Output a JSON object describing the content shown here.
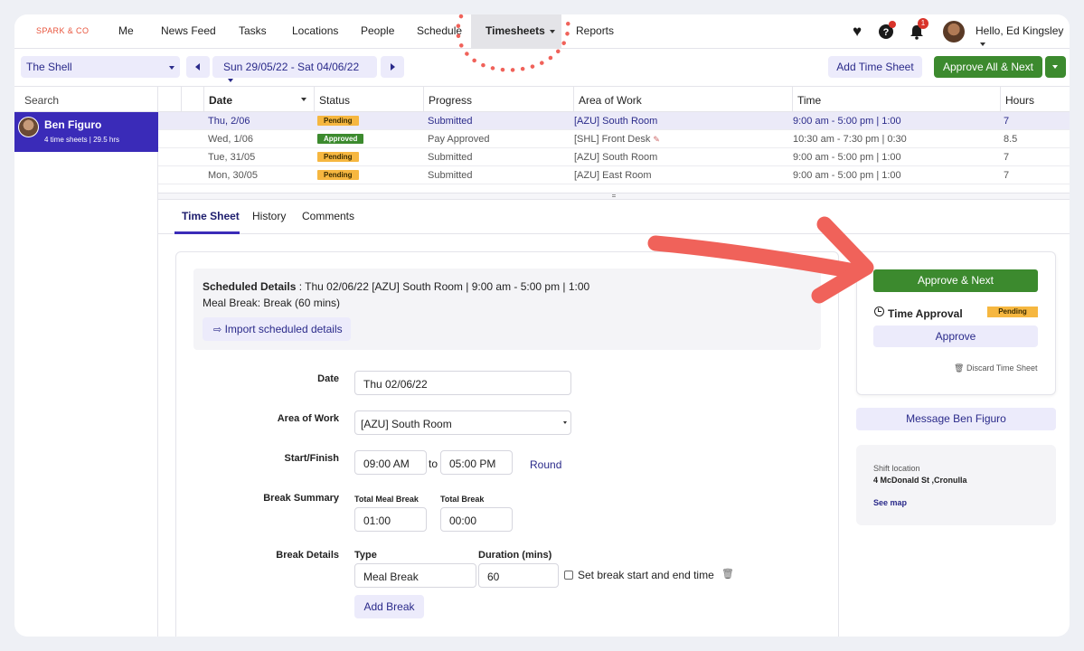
{
  "brand": "SPARK & CO",
  "nav": {
    "items": [
      "Me",
      "News Feed",
      "Tasks",
      "Locations",
      "People",
      "Schedule",
      "Timesheets",
      "Reports"
    ],
    "active": "Timesheets",
    "notifications_count": "1",
    "greeting": "Hello, Ed Kingsley"
  },
  "toolbar": {
    "location": "The Shell",
    "date_range": "Sun 29/05/22 - Sat 04/06/22",
    "add_time_sheet": "Add Time Sheet",
    "approve_all": "Approve All & Next"
  },
  "sidebar": {
    "search_placeholder": "Search",
    "employee": {
      "name": "Ben Figuro",
      "summary": "4 time sheets | 29.5 hrs"
    }
  },
  "table": {
    "headers": [
      "Date",
      "Status",
      "Progress",
      "Area of Work",
      "Time",
      "Hours"
    ],
    "rows": [
      {
        "date": "Thu, 2/06",
        "status": "Pending",
        "progress": "Submitted",
        "area": "[AZU] South Room",
        "time": "9:00 am - 5:00 pm | 1:00",
        "hours": "7"
      },
      {
        "date": "Wed, 1/06",
        "status": "Approved",
        "progress": "Pay Approved",
        "area": "[SHL] Front Desk",
        "time": "10:30 am - 7:30 pm | 0:30",
        "hours": "8.5"
      },
      {
        "date": "Tue, 31/05",
        "status": "Pending",
        "progress": "Submitted",
        "area": "[AZU] South Room",
        "time": "9:00 am - 5:00 pm | 1:00",
        "hours": "7"
      },
      {
        "date": "Mon, 30/05",
        "status": "Pending",
        "progress": "Submitted",
        "area": "[AZU] East Room",
        "time": "9:00 am - 5:00 pm | 1:00",
        "hours": "7"
      }
    ]
  },
  "tabs": [
    "Time Sheet",
    "History",
    "Comments"
  ],
  "scheduled": {
    "label": "Scheduled Details",
    "value": " : Thu 02/06/22 [AZU] South Room | 9:00 am - 5:00 pm | 1:00",
    "meal_break": "Meal Break: Break (60 mins)",
    "import_label": "Import scheduled details"
  },
  "form": {
    "date_label": "Date",
    "date_value": "Thu 02/06/22",
    "area_label": "Area of Work",
    "area_value": "[AZU] South Room",
    "start_finish_label": "Start/Finish",
    "start_value": "09:00 AM",
    "to_label": "to",
    "finish_value": "05:00 PM",
    "round_label": "Round",
    "break_summary_label": "Break Summary",
    "total_meal_break_label": "Total Meal Break",
    "total_meal_break_value": "01:00",
    "total_break_label": "Total Break",
    "total_break_value": "00:00",
    "break_details_label": "Break Details",
    "type_label": "Type",
    "duration_label": "Duration (mins)",
    "break_type_value": "Meal Break",
    "break_duration_value": "60",
    "set_break_label": "Set break start and end time",
    "add_break_label": "Add Break"
  },
  "right_panel": {
    "approve_next": "Approve & Next",
    "time_approval_label": "Time Approval",
    "time_approval_status": "Pending",
    "approve_label": "Approve",
    "discard_label": "Discard Time Sheet",
    "message_label": "Message Ben Figuro",
    "shift_location_label": "Shift location",
    "shift_location_address": "4 McDonald St ,Cronulla",
    "see_map_label": "See map"
  },
  "colors": {
    "accent": "#3a2bb8",
    "approve_green": "#3c8a2e",
    "pending_yellow": "#f6b740",
    "annotation_red": "#f0625a"
  }
}
